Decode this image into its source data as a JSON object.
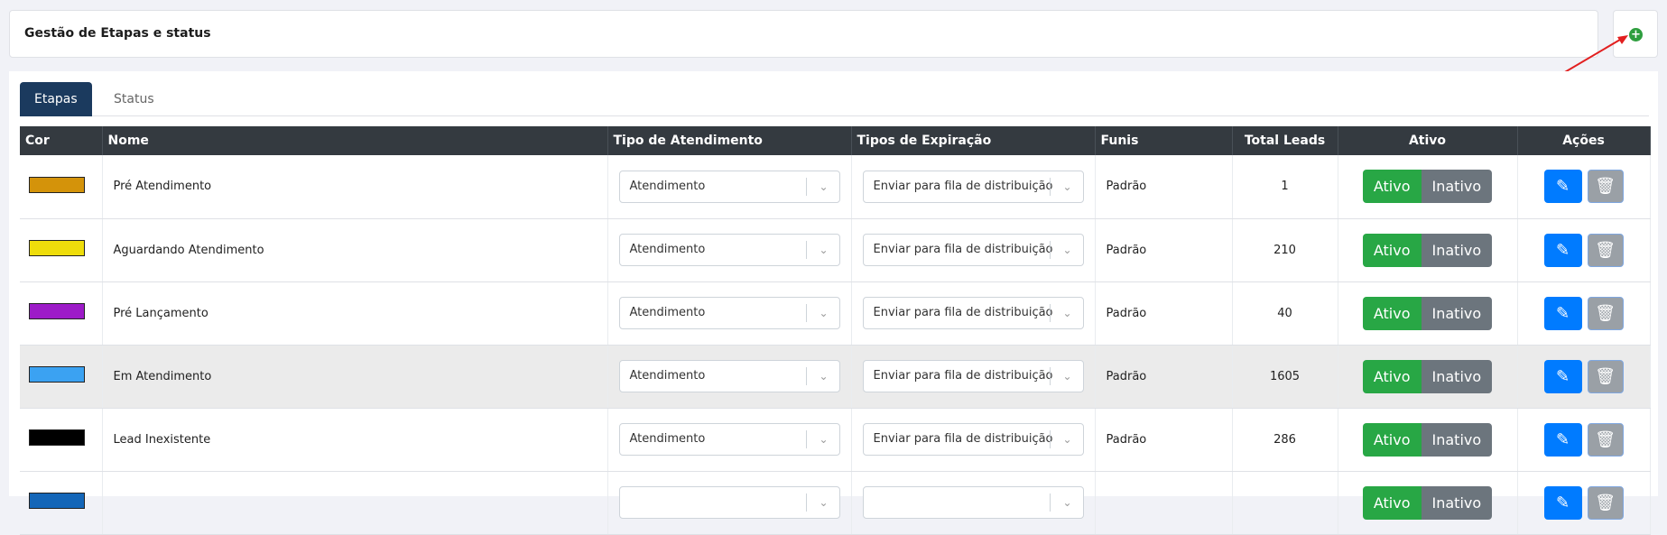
{
  "header": {
    "title": "Gestão de Etapas e status"
  },
  "tabs": [
    {
      "label": "Etapas"
    },
    {
      "label": "Status"
    }
  ],
  "table": {
    "columns": [
      "Cor",
      "Nome",
      "Tipo de Atendimento",
      "Tipos de Expiração",
      "Funis",
      "Total Leads",
      "Ativo",
      "Ações"
    ],
    "toggle_on": "Ativo",
    "toggle_off": "Inativo",
    "rows": [
      {
        "color": "#d4930a",
        "name": "Pré Atendimento",
        "tipo": "Atendimento",
        "expiracao": "Enviar para fila de distribuição",
        "funis": "Padrão",
        "total": "1"
      },
      {
        "color": "#eedd0b",
        "name": "Aguardando Atendimento",
        "tipo": "Atendimento",
        "expiracao": "Enviar para fila de distribuição",
        "funis": "Padrão",
        "total": "210"
      },
      {
        "color": "#9d1bc8",
        "name": "Pré Lançamento",
        "tipo": "Atendimento",
        "expiracao": "Enviar para fila de distribuição",
        "funis": "Padrão",
        "total": "40"
      },
      {
        "color": "#3ba2f2",
        "name": "Em Atendimento",
        "tipo": "Atendimento",
        "expiracao": "Enviar para fila de distribuição",
        "funis": "Padrão",
        "total": "1605"
      },
      {
        "color": "#000000",
        "name": "Lead Inexistente",
        "tipo": "Atendimento",
        "expiracao": "Enviar para fila de distribuição",
        "funis": "Padrão",
        "total": "286"
      },
      {
        "color": "#1466b8",
        "name": "",
        "tipo": "",
        "expiracao": "",
        "funis": "",
        "total": ""
      }
    ]
  }
}
